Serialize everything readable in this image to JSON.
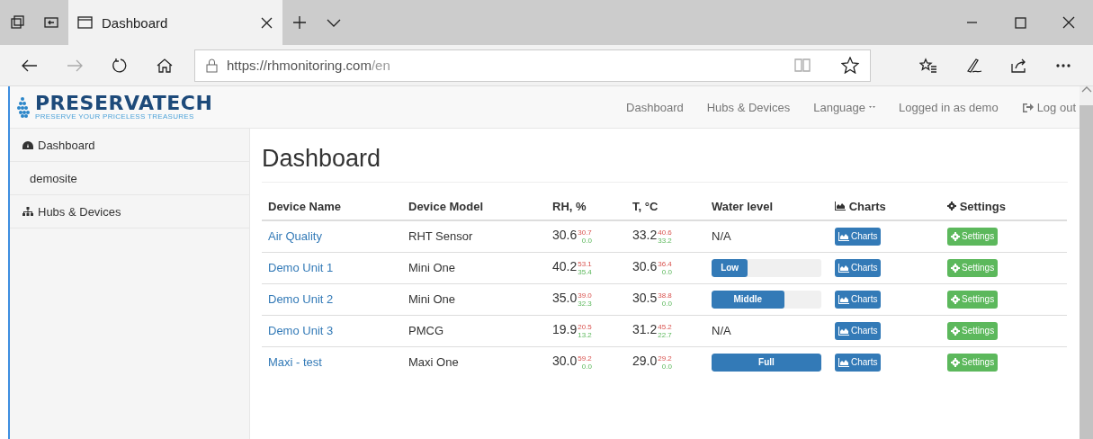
{
  "browser": {
    "tab_title": "Dashboard",
    "url_host": "https://rhmonitoring.com",
    "url_path": "/en"
  },
  "brand": {
    "name": "PRESERVATECH",
    "tagline": "PRESERVE YOUR PRICELESS TREASURES"
  },
  "nav": [
    {
      "label": "Dashboard",
      "kind": "link"
    },
    {
      "label": "Hubs & Devices",
      "kind": "link"
    },
    {
      "label": "Language",
      "kind": "dropdown"
    },
    {
      "label": "Logged in as demo",
      "kind": "link"
    },
    {
      "label": "Log out",
      "kind": "logout"
    }
  ],
  "sidebar": {
    "items": [
      {
        "label": "Dashboard",
        "kind": "dashboard"
      },
      {
        "label": "demosite",
        "kind": "sub"
      },
      {
        "label": "Hubs & Devices",
        "kind": "hubs"
      }
    ]
  },
  "page_title": "Dashboard",
  "table": {
    "columns": [
      "Device Name",
      "Device Model",
      "RH, %",
      "T, °C",
      "Water level",
      "Charts",
      "Settings"
    ],
    "rows": [
      {
        "name": "Air Quality",
        "model": "RHT Sensor",
        "rh": "30.6",
        "rh_max": "30.7",
        "rh_min": "0.0",
        "t": "33.2",
        "t_max": "40.6",
        "t_min": "33.2",
        "water": {
          "kind": "text",
          "text": "N/A"
        },
        "charts": "Charts",
        "settings": "Settings"
      },
      {
        "name": "Demo Unit 1",
        "model": "Mini One",
        "rh": "40.2",
        "rh_max": "53.1",
        "rh_min": "35.4",
        "t": "30.6",
        "t_max": "36.4",
        "t_min": "0.0",
        "water": {
          "kind": "bar",
          "label": "Low",
          "level": 0.33
        },
        "charts": "Charts",
        "settings": "Settings"
      },
      {
        "name": "Demo Unit 2",
        "model": "Mini One",
        "rh": "35.0",
        "rh_max": "39.0",
        "rh_min": "32.3",
        "t": "30.5",
        "t_max": "38.8",
        "t_min": "0.0",
        "water": {
          "kind": "bar",
          "label": "Middle",
          "level": 0.66
        },
        "charts": "Charts",
        "settings": "Settings"
      },
      {
        "name": "Demo Unit 3",
        "model": "PMCG",
        "rh": "19.9",
        "rh_max": "20.5",
        "rh_min": "13.2",
        "t": "31.2",
        "t_max": "45.2",
        "t_min": "22.7",
        "water": {
          "kind": "text",
          "text": "N/A"
        },
        "charts": "Charts",
        "settings": "Settings"
      },
      {
        "name": "Maxi - test",
        "model": "Maxi One",
        "rh": "30.0",
        "rh_max": "59.2",
        "rh_min": "0.0",
        "t": "29.0",
        "t_max": "29.2",
        "t_min": "0.0",
        "water": {
          "kind": "bar",
          "label": "Full",
          "level": 1
        },
        "charts": "Charts",
        "settings": "Settings"
      }
    ]
  }
}
